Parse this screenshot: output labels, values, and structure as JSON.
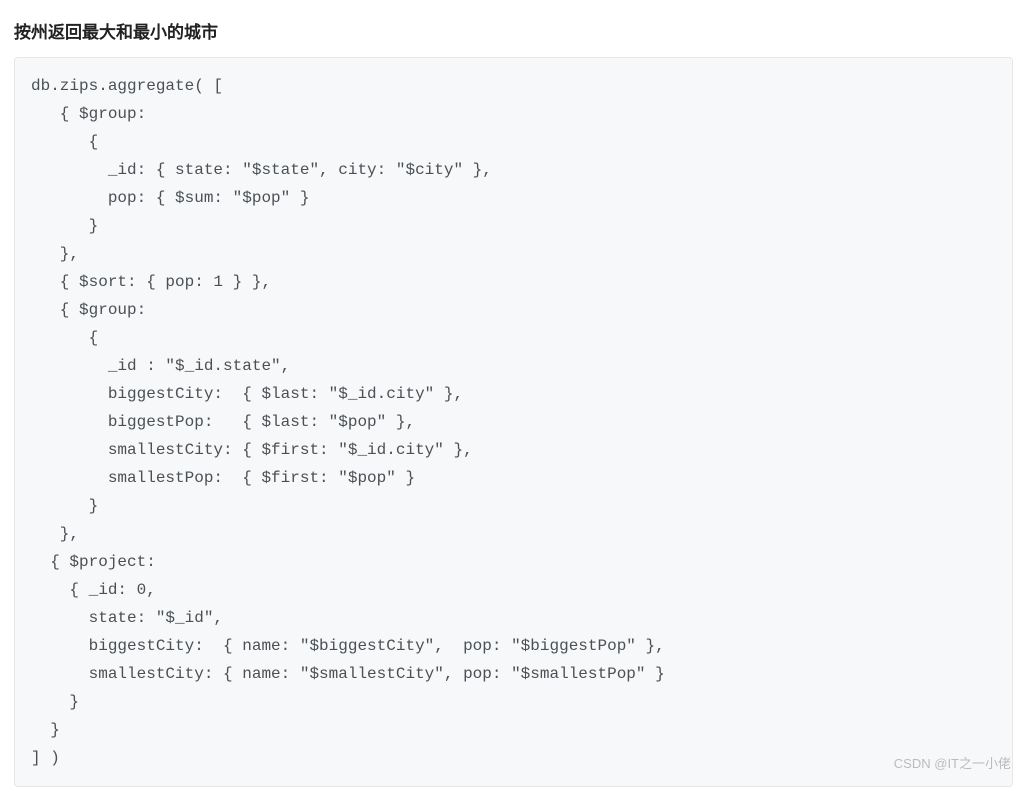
{
  "heading": "按州返回最大和最小的城市",
  "code": "db.zips.aggregate( [\n   { $group:\n      {\n        _id: { state: \"$state\", city: \"$city\" },\n        pop: { $sum: \"$pop\" }\n      }\n   },\n   { $sort: { pop: 1 } },\n   { $group:\n      {\n        _id : \"$_id.state\",\n        biggestCity:  { $last: \"$_id.city\" },\n        biggestPop:   { $last: \"$pop\" },\n        smallestCity: { $first: \"$_id.city\" },\n        smallestPop:  { $first: \"$pop\" }\n      }\n   },\n  { $project:\n    { _id: 0,\n      state: \"$_id\",\n      biggestCity:  { name: \"$biggestCity\",  pop: \"$biggestPop\" },\n      smallestCity: { name: \"$smallestCity\", pop: \"$smallestPop\" }\n    }\n  }\n] )",
  "watermark": "CSDN @IT之一小佬"
}
